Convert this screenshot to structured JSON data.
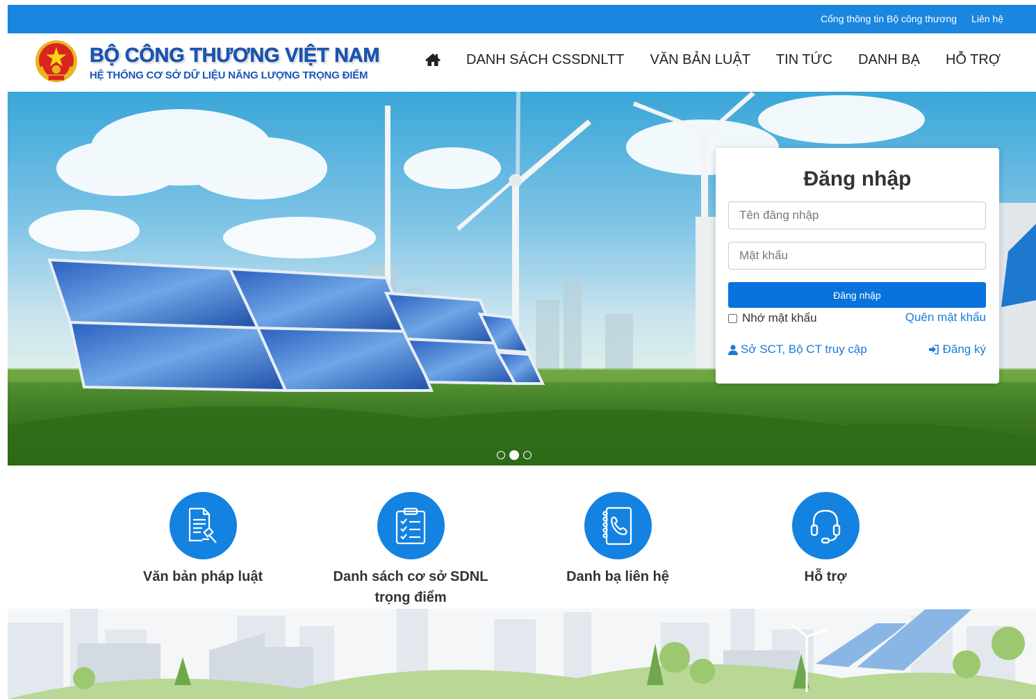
{
  "topbar": {
    "link1": "Cổng thông tin Bộ công thương",
    "link2": "Liên hệ"
  },
  "brand": {
    "title": "BỘ CÔNG THƯƠNG VIỆT NAM",
    "subtitle": "HỆ THỐNG CƠ SỞ DỮ LIỆU NĂNG LƯỢNG TRỌNG ĐIỂM"
  },
  "nav": {
    "items": [
      "DANH SÁCH CSSDNLTT",
      "VĂN BẢN LUẬT",
      "TIN TỨC",
      "DANH BẠ",
      "HỖ TRỢ"
    ]
  },
  "login": {
    "title": "Đăng nhập",
    "username_placeholder": "Tên đăng nhập",
    "password_placeholder": "Mật khẩu",
    "submit": "Đăng nhập",
    "remember": "Nhớ mật khẩu",
    "forgot": "Quên mật khẩu",
    "sct_access": "Sở SCT, Bộ CT truy cập",
    "register": "Đăng ký"
  },
  "carousel": {
    "active_index": 1,
    "count": 3
  },
  "features": [
    {
      "label": "Văn bản pháp luật",
      "icon": "document-icon"
    },
    {
      "label": "Danh sách cơ sở SDNL trọng điểm",
      "icon": "checklist-icon"
    },
    {
      "label": "Danh bạ liên hệ",
      "icon": "phonebook-icon"
    },
    {
      "label": "Hỗ trợ",
      "icon": "headset-icon"
    }
  ],
  "colors": {
    "primary": "#1a86e0",
    "brand": "#1a56b8",
    "button": "#0a72dc",
    "link": "#1a7bd6"
  }
}
